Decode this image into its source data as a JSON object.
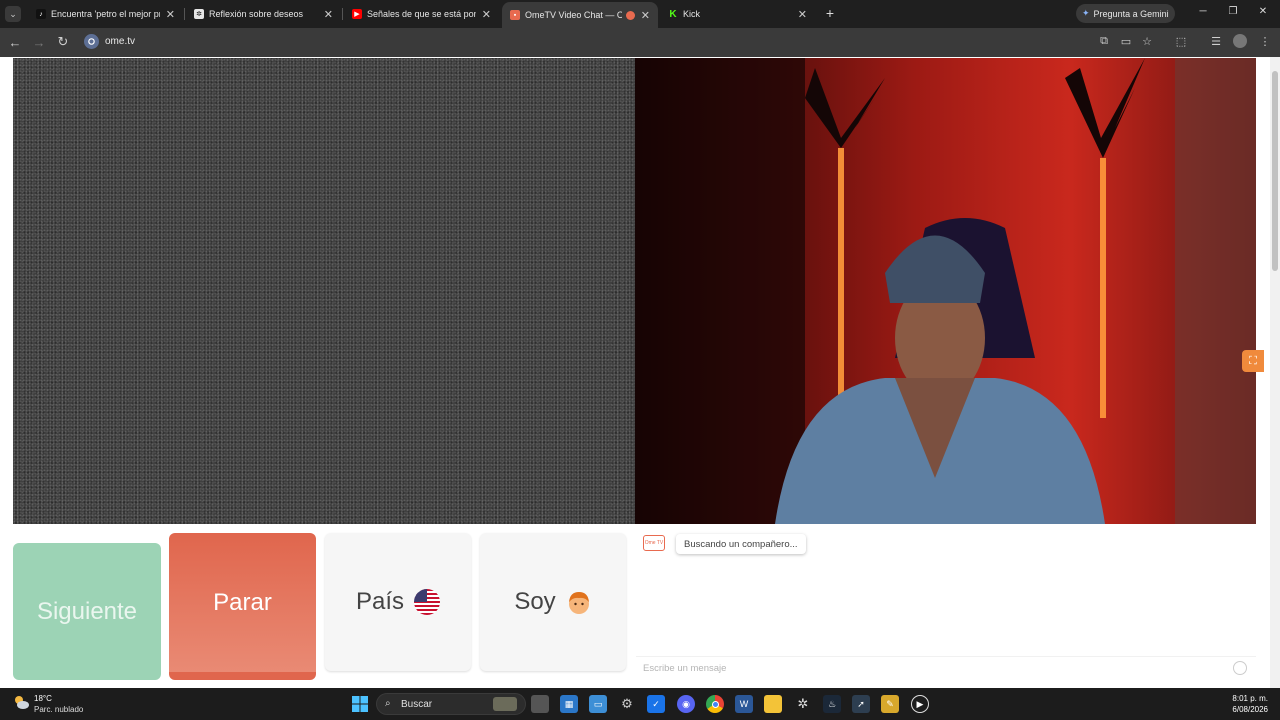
{
  "browser": {
    "tabs": [
      {
        "label": "Encuentra 'petro el mejor presi",
        "icon": "tiktok-icon",
        "color": "#111111"
      },
      {
        "label": "Reflexión sobre deseos",
        "icon": "chatgpt-icon",
        "color": "#e6e6e6"
      },
      {
        "label": "Señales de que se está ponienc",
        "icon": "youtube-icon",
        "color": "#ff0000"
      },
      {
        "label": "OmeTV Video Chat — Ome",
        "icon": "ometv-icon",
        "color": "#e86a4f"
      },
      {
        "label": "Kick",
        "icon": "kick-icon",
        "color": "#53fc18"
      }
    ],
    "gemini_label": "Pregunta a Gemini",
    "url": "ome.tv"
  },
  "controls": {
    "next_label": "Siguiente",
    "stop_label": "Parar",
    "country_label": "País",
    "country_flag": "us-flag-icon",
    "gender_label": "Soy",
    "gender_icon": "boy-face-icon"
  },
  "chat": {
    "status_message": "Buscando un compañero...",
    "input_placeholder": "Escribe un mensaje",
    "logo_text": "Ome TV"
  },
  "taskbar": {
    "temperature": "18°C",
    "weather": "Parc. nublado",
    "search_label": "Buscar",
    "time": "8:01 p. m.",
    "date": "6/08/2026"
  },
  "colors": {
    "next_button": "#9cd3b5",
    "stop_button": "#e0664d",
    "accent": "#f08a3c"
  }
}
